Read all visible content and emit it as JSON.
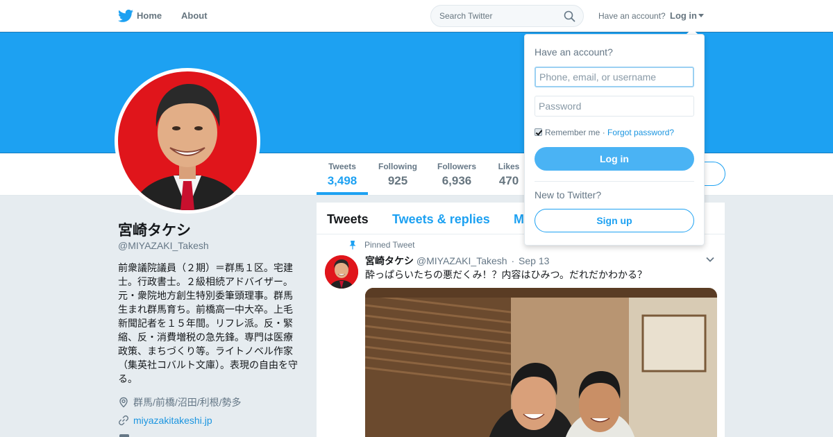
{
  "nav": {
    "home_label": "Home",
    "about_label": "About",
    "search_placeholder": "Search Twitter",
    "have_account": "Have an account?",
    "login_label": "Log in"
  },
  "profile": {
    "name": "宮崎タケシ",
    "handle": "@MIYAZAKI_Takesh",
    "bio": "前衆議院議員（２期）＝群馬１区。宅建士。行政書士。２級相続アドバイザー。元・衆院地方創生特別委筆頭理事。群馬生まれ群馬育ち。前橋高一中大卒。上毛新聞記者を１５年間。リフレ派。反・緊縮、反・消費増税の急先鋒。専門は医療政策、まちづくり等。ライトノベル作家（集英社コバルト文庫）。表現の自由を守る。",
    "location": "群馬/前橋/沼田/利根/勢多",
    "url": "miyazakitakeshi.jp"
  },
  "stats": [
    {
      "label": "Tweets",
      "value": "3,498"
    },
    {
      "label": "Following",
      "value": "925"
    },
    {
      "label": "Followers",
      "value": "6,936"
    },
    {
      "label": "Likes",
      "value": "470"
    }
  ],
  "timeline": {
    "tabs": [
      "Tweets",
      "Tweets & replies",
      "M"
    ],
    "pinned_label": "Pinned Tweet",
    "tweet": {
      "fullname": "宮崎タケシ",
      "screen_name": "@MIYAZAKI_Takesh",
      "date": "Sep 13",
      "text": "酔っぱらいたちの悪だくみ！？内容はひみつ。だれだかわかる？"
    }
  },
  "login_dropdown": {
    "title": "Have an account?",
    "username_placeholder": "Phone, email, or username",
    "password_placeholder": "Password",
    "remember_label": "Remember me",
    "forgot_label": "Forgot password?",
    "login_button": "Log in",
    "new_label": "New to Twitter?",
    "signup_button": "Sign up"
  },
  "colors": {
    "accent": "#1da1f2",
    "banner": "#1da1f2",
    "avatar_background": "#e0151b"
  }
}
